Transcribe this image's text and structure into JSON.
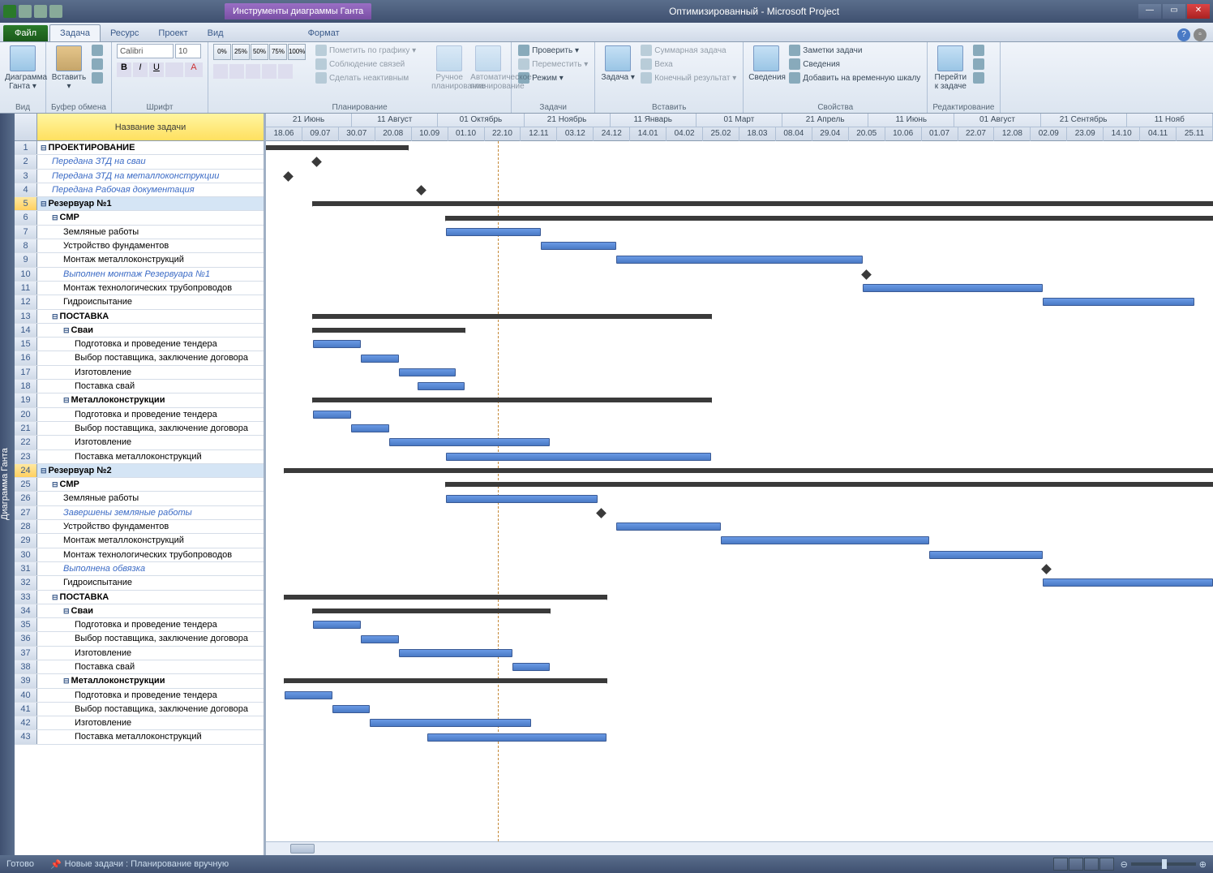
{
  "title": {
    "tool_tab": "Инструменты диаграммы Ганта",
    "doc": "Оптимизированный - Microsoft Project"
  },
  "menu": {
    "file": "Файл",
    "tabs": [
      "Задача",
      "Ресурс",
      "Проект",
      "Вид"
    ],
    "format": "Формат"
  },
  "ribbon": {
    "view": {
      "gantt": "Диаграмма Ганта ▾",
      "label": "Вид"
    },
    "clipboard": {
      "paste": "Вставить ▾",
      "label": "Буфер обмена"
    },
    "font": {
      "name": "Calibri",
      "size": "10",
      "label": "Шрифт"
    },
    "pct": [
      "0%",
      "25%",
      "50%",
      "75%",
      "100%"
    ],
    "planning": {
      "mark": "Пометить по графику ▾",
      "links": "Соблюдение связей",
      "inactive": "Сделать неактивным",
      "manual": "Ручное планирование",
      "auto": "Автоматическое планирование",
      "label": "Планирование"
    },
    "tasks": {
      "check": "Проверить ▾",
      "move": "Переместить ▾",
      "mode": "Режим ▾",
      "task": "Задача ▾",
      "summary": "Суммарная задача",
      "milestone": "Веха",
      "final": "Конечный результат ▾",
      "label": "Задачи",
      "insert_label": "Вставить"
    },
    "info": {
      "info": "Сведения",
      "notes": "Заметки задачи",
      "details": "Сведения",
      "timeline": "Добавить на временную шкалу",
      "label": "Свойства"
    },
    "edit": {
      "goto": "Перейти к задаче",
      "label": "Редактирование"
    }
  },
  "sidebar": "Диаграмма Ганта",
  "table": {
    "header": "Название задачи"
  },
  "timeline": {
    "months": [
      "21 Июнь",
      "11 Август",
      "01 Октябрь",
      "21 Ноябрь",
      "11 Январь",
      "01 Март",
      "21 Апрель",
      "11 Июнь",
      "01 Август",
      "21 Сентябрь",
      "11 Нояб"
    ],
    "days": [
      "18.06",
      "09.07",
      "30.07",
      "20.08",
      "10.09",
      "01.10",
      "22.10",
      "12.11",
      "03.12",
      "24.12",
      "14.01",
      "04.02",
      "25.02",
      "18.03",
      "08.04",
      "29.04",
      "20.05",
      "10.06",
      "01.07",
      "22.07",
      "12.08",
      "02.09",
      "23.09",
      "14.10",
      "04.11",
      "25.11"
    ]
  },
  "tasks": [
    {
      "id": 1,
      "name": "ПРОЕКТИРОВАНИЕ",
      "lvl": 0,
      "bold": true,
      "c": true,
      "type": "summary",
      "start": 0,
      "end": 15
    },
    {
      "id": 2,
      "name": "Передана ЗТД на сваи",
      "lvl": 1,
      "blue": true,
      "type": "milestone",
      "at": 5
    },
    {
      "id": 3,
      "name": "Передана ЗТД на металлоконструкции",
      "lvl": 1,
      "blue": true,
      "type": "milestone",
      "at": 2
    },
    {
      "id": 4,
      "name": "Передана Рабочая документация",
      "lvl": 1,
      "blue": true,
      "type": "milestone",
      "at": 16
    },
    {
      "id": 5,
      "name": "Резервуар №1",
      "lvl": 0,
      "bold": true,
      "c": true,
      "sel": true,
      "type": "summary",
      "start": 5,
      "end": 100
    },
    {
      "id": 6,
      "name": "СМР",
      "lvl": 1,
      "bold": true,
      "c": true,
      "type": "summary",
      "start": 19,
      "end": 100
    },
    {
      "id": 7,
      "name": "Земляные работы",
      "lvl": 2,
      "type": "bar",
      "start": 19,
      "end": 29
    },
    {
      "id": 8,
      "name": "Устройство фундаментов",
      "lvl": 2,
      "type": "bar",
      "start": 29,
      "end": 37
    },
    {
      "id": 9,
      "name": "Монтаж металлоконструкций",
      "lvl": 2,
      "type": "bar",
      "start": 37,
      "end": 63
    },
    {
      "id": 10,
      "name": "Выполнен монтаж Резервуара №1",
      "lvl": 2,
      "blue": true,
      "type": "milestone",
      "at": 63
    },
    {
      "id": 11,
      "name": "Монтаж технологических трубопроводов",
      "lvl": 2,
      "type": "bar",
      "start": 63,
      "end": 82
    },
    {
      "id": 12,
      "name": "Гидроиспытание",
      "lvl": 2,
      "type": "bar",
      "start": 82,
      "end": 98
    },
    {
      "id": 13,
      "name": "ПОСТАВКА",
      "lvl": 1,
      "bold": true,
      "c": true,
      "type": "summary",
      "start": 5,
      "end": 47
    },
    {
      "id": 14,
      "name": "Сваи",
      "lvl": 2,
      "bold": true,
      "c": true,
      "type": "summary",
      "start": 5,
      "end": 21
    },
    {
      "id": 15,
      "name": "Подготовка и проведение тендера",
      "lvl": 3,
      "type": "bar",
      "start": 5,
      "end": 10
    },
    {
      "id": 16,
      "name": "Выбор поставщика, заключение договора",
      "lvl": 3,
      "type": "bar",
      "start": 10,
      "end": 14
    },
    {
      "id": 17,
      "name": "Изготовление",
      "lvl": 3,
      "type": "bar",
      "start": 14,
      "end": 20
    },
    {
      "id": 18,
      "name": "Поставка свай",
      "lvl": 3,
      "type": "bar",
      "start": 16,
      "end": 21
    },
    {
      "id": 19,
      "name": "Металлоконструкции",
      "lvl": 2,
      "bold": true,
      "c": true,
      "type": "summary",
      "start": 5,
      "end": 47
    },
    {
      "id": 20,
      "name": "Подготовка и проведение тендера",
      "lvl": 3,
      "type": "bar",
      "start": 5,
      "end": 9
    },
    {
      "id": 21,
      "name": "Выбор поставщика, заключение договора",
      "lvl": 3,
      "type": "bar",
      "start": 9,
      "end": 13
    },
    {
      "id": 22,
      "name": "Изготовление",
      "lvl": 3,
      "type": "bar",
      "start": 13,
      "end": 30
    },
    {
      "id": 23,
      "name": "Поставка металлоконструкций",
      "lvl": 3,
      "type": "bar",
      "start": 19,
      "end": 47
    },
    {
      "id": 24,
      "name": "Резервуар №2",
      "lvl": 0,
      "bold": true,
      "c": true,
      "sel": true,
      "type": "summary",
      "start": 2,
      "end": 100
    },
    {
      "id": 25,
      "name": "СМР",
      "lvl": 1,
      "bold": true,
      "c": true,
      "type": "summary",
      "start": 19,
      "end": 100
    },
    {
      "id": 26,
      "name": "Земляные работы",
      "lvl": 2,
      "type": "bar",
      "start": 19,
      "end": 35
    },
    {
      "id": 27,
      "name": "Завершены земляные работы",
      "lvl": 2,
      "blue": true,
      "type": "milestone",
      "at": 35
    },
    {
      "id": 28,
      "name": "Устройство фундаментов",
      "lvl": 2,
      "type": "bar",
      "start": 37,
      "end": 48
    },
    {
      "id": 29,
      "name": "Монтаж металлоконструкций",
      "lvl": 2,
      "type": "bar",
      "start": 48,
      "end": 70
    },
    {
      "id": 30,
      "name": "Монтаж технологических трубопроводов",
      "lvl": 2,
      "type": "bar",
      "start": 70,
      "end": 82
    },
    {
      "id": 31,
      "name": "Выполнена обвязка",
      "lvl": 2,
      "blue": true,
      "type": "milestone",
      "at": 82
    },
    {
      "id": 32,
      "name": "Гидроиспытание",
      "lvl": 2,
      "type": "bar",
      "start": 82,
      "end": 100
    },
    {
      "id": 33,
      "name": "ПОСТАВКА",
      "lvl": 1,
      "bold": true,
      "c": true,
      "type": "summary",
      "start": 2,
      "end": 36
    },
    {
      "id": 34,
      "name": "Сваи",
      "lvl": 2,
      "bold": true,
      "c": true,
      "type": "summary",
      "start": 5,
      "end": 30
    },
    {
      "id": 35,
      "name": "Подготовка и проведение тендера",
      "lvl": 3,
      "type": "bar",
      "start": 5,
      "end": 10
    },
    {
      "id": 36,
      "name": "Выбор поставщика, заключение договора",
      "lvl": 3,
      "type": "bar",
      "start": 10,
      "end": 14
    },
    {
      "id": 37,
      "name": "Изготовление",
      "lvl": 3,
      "type": "bar",
      "start": 14,
      "end": 26
    },
    {
      "id": 38,
      "name": "Поставка свай",
      "lvl": 3,
      "type": "bar",
      "start": 26,
      "end": 30
    },
    {
      "id": 39,
      "name": "Металлоконструкции",
      "lvl": 2,
      "bold": true,
      "c": true,
      "type": "summary",
      "start": 2,
      "end": 36
    },
    {
      "id": 40,
      "name": "Подготовка и проведение тендера",
      "lvl": 3,
      "type": "bar",
      "start": 2,
      "end": 7
    },
    {
      "id": 41,
      "name": "Выбор поставщика, заключение договора",
      "lvl": 3,
      "type": "bar",
      "start": 7,
      "end": 11
    },
    {
      "id": 42,
      "name": "Изготовление",
      "lvl": 3,
      "type": "bar",
      "start": 11,
      "end": 28
    },
    {
      "id": 43,
      "name": "Поставка металлоконструкций",
      "lvl": 3,
      "type": "bar",
      "start": 17,
      "end": 36
    }
  ],
  "status": {
    "ready": "Готово",
    "newtasks": "Новые задачи : Планирование вручную"
  }
}
